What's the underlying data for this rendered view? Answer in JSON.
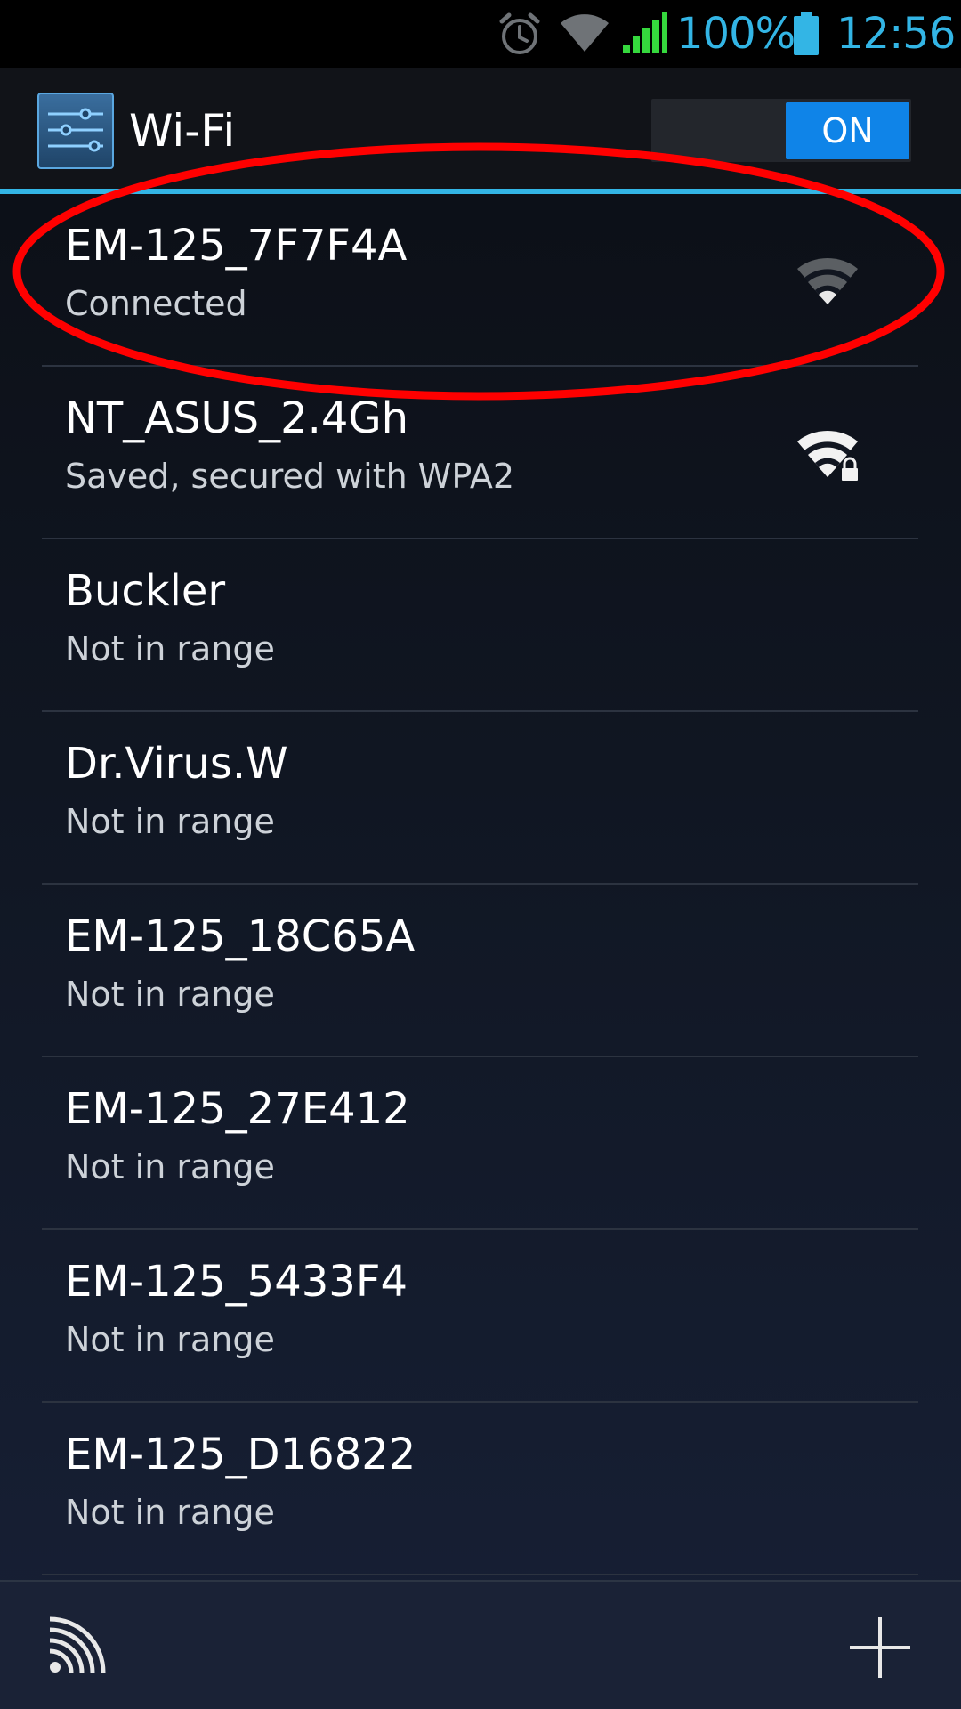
{
  "status_bar": {
    "battery_percent": "100%",
    "time": "12:56",
    "icons": [
      "alarm-icon",
      "wifi-status-icon",
      "cell-signal-icon",
      "battery-icon"
    ],
    "colors": {
      "text": "#33b5e5",
      "cell_signal": "#35d83d"
    }
  },
  "action_bar": {
    "title": "Wi-Fi",
    "toggle_label": "ON",
    "toggle_state": "on",
    "app_icon": "settings-sliders-icon"
  },
  "networks": [
    {
      "name": "EM-125_7F7F4A",
      "status": "Connected",
      "signal_icon": "wifi-signal-icon",
      "secured": false
    },
    {
      "name": "NT_ASUS_2.4Gh",
      "status": "Saved, secured with WPA2",
      "signal_icon": "wifi-signal-lock-icon",
      "secured": true
    },
    {
      "name": "Buckler",
      "status": "Not in range"
    },
    {
      "name": "Dr.Virus.W",
      "status": "Not in range"
    },
    {
      "name": "EM-125_18C65A",
      "status": "Not in range"
    },
    {
      "name": "EM-125_27E412",
      "status": "Not in range"
    },
    {
      "name": "EM-125_5433F4",
      "status": "Not in range"
    },
    {
      "name": "EM-125_D16822",
      "status": "Not in range"
    }
  ],
  "highlight": {
    "color": "#ff0000",
    "target": "networks.0"
  },
  "bottom_bar": {
    "left_icon": "wps-icon",
    "right_icon": "add-icon"
  },
  "colors": {
    "accent": "#33b5e5",
    "toggle_on": "#0f84e8"
  }
}
